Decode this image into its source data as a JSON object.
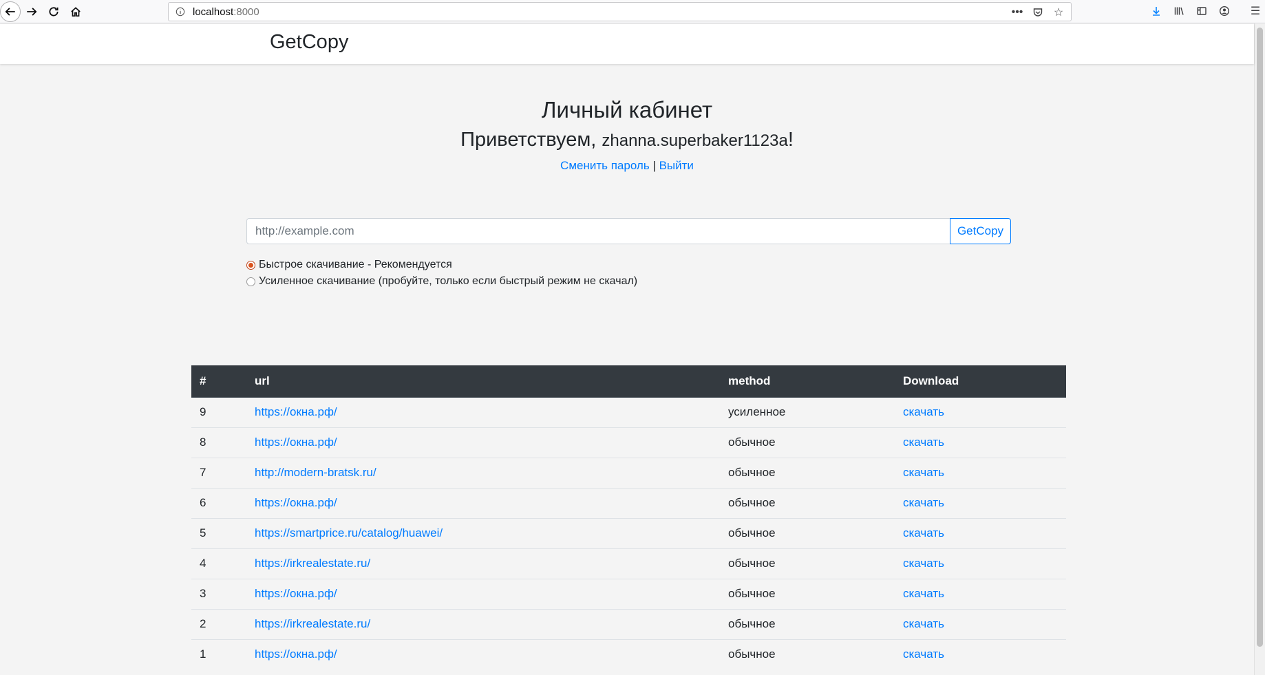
{
  "browser": {
    "url_host": "localhost",
    "url_port": ":8000"
  },
  "header": {
    "brand": "GetCopy"
  },
  "page": {
    "title": "Личный кабинет",
    "greeting_prefix": "Приветствуем, ",
    "username": "zhanna.superbaker1123a",
    "greeting_suffix": "!",
    "change_password": "Сменить пароль",
    "separator": "|",
    "logout": "Выйти"
  },
  "form": {
    "placeholder": "http://example.com",
    "value": "",
    "submit_label": "GetCopy",
    "options": [
      {
        "label": "Быстрое скачивание - Рекомендуется",
        "checked": true
      },
      {
        "label": "Усиленное скачивание (пробуйте, только если быстрый режим не скачал)",
        "checked": false
      }
    ]
  },
  "table": {
    "headers": [
      "#",
      "url",
      "method",
      "Download"
    ],
    "rows": [
      {
        "num": "9",
        "url": "https://окна.рф/",
        "method": "усиленное",
        "download": "скачать"
      },
      {
        "num": "8",
        "url": "https://окна.рф/",
        "method": "обычное",
        "download": "скачать"
      },
      {
        "num": "7",
        "url": "http://modern-bratsk.ru/",
        "method": "обычное",
        "download": "скачать"
      },
      {
        "num": "6",
        "url": "https://окна.рф/",
        "method": "обычное",
        "download": "скачать"
      },
      {
        "num": "5",
        "url": "https://smartprice.ru/catalog/huawei/",
        "method": "обычное",
        "download": "скачать"
      },
      {
        "num": "4",
        "url": "https://irkrealestate.ru/",
        "method": "обычное",
        "download": "скачать"
      },
      {
        "num": "3",
        "url": "https://окна.рф/",
        "method": "обычное",
        "download": "скачать"
      },
      {
        "num": "2",
        "url": "https://irkrealestate.ru/",
        "method": "обычное",
        "download": "скачать"
      },
      {
        "num": "1",
        "url": "https://окна.рф/",
        "method": "обычное",
        "download": "скачать"
      }
    ]
  },
  "colors": {
    "link": "#007bff",
    "table_header_bg": "#343a40",
    "page_bg": "#f4f4f4"
  }
}
